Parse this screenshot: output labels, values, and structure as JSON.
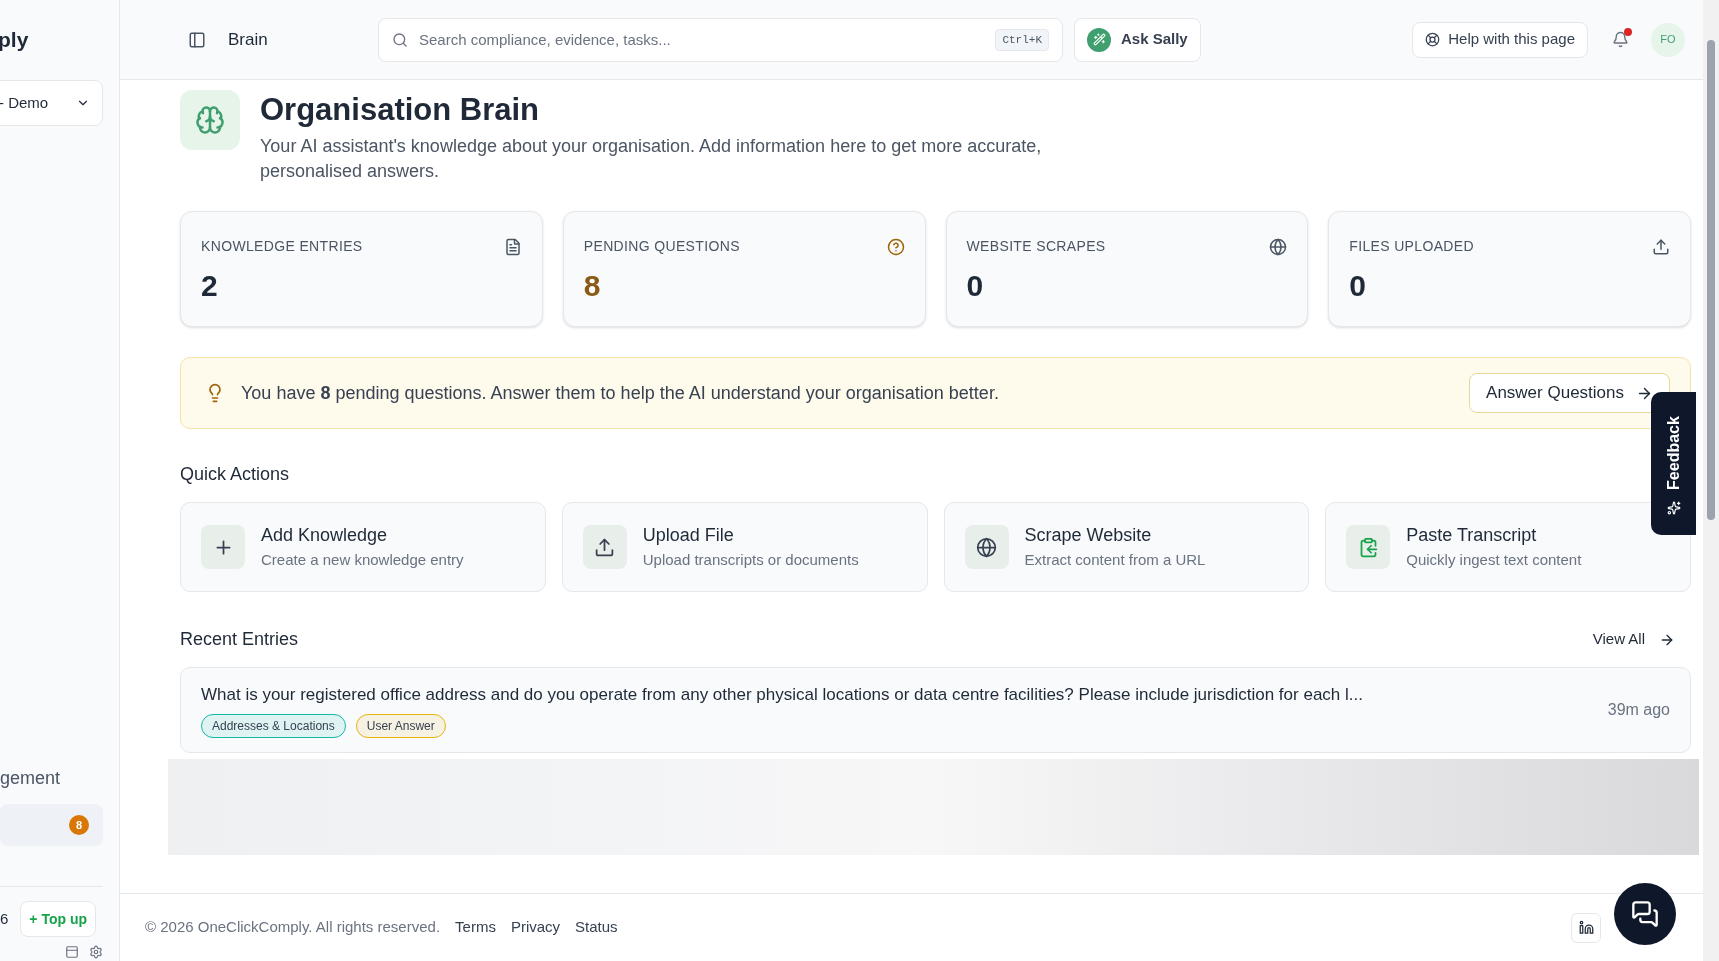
{
  "sidebar": {
    "brand": "ply",
    "org_selector": "- Demo",
    "section_label": "gement",
    "item_badge": "8",
    "credits": "6",
    "top_up": "+ Top up"
  },
  "header": {
    "title": "Brain",
    "search": {
      "placeholder": "Search compliance, evidence, tasks..."
    },
    "shortcut": "Ctrl+K",
    "assistant_button": "Ask Sally",
    "help_button": "Help with this page",
    "notifications_unread": true,
    "avatar": "FO"
  },
  "page": {
    "title": "Organisation Brain",
    "description": "Your AI assistant's knowledge about your organisation. Add information here to get more accurate, personalised answers."
  },
  "stats": [
    {
      "label": "KNOWLEDGE ENTRIES",
      "value": "2",
      "kind": "document",
      "highlighted": false
    },
    {
      "label": "PENDING QUESTIONS",
      "value": "8",
      "kind": "question",
      "highlighted": true
    },
    {
      "label": "WEBSITE SCRAPES",
      "value": "0",
      "kind": "globe",
      "highlighted": false
    },
    {
      "label": "FILES UPLOADED",
      "value": "0",
      "kind": "upload",
      "highlighted": false
    }
  ],
  "banner": {
    "message": "You have **8** pending questions. Answer them to help the AI understand your organisation better.",
    "button": "Answer Questions"
  },
  "quick_actions": {
    "title": "Quick Actions",
    "items": [
      {
        "title": "Add Knowledge",
        "subtitle": "Create a new knowledge entry",
        "kind": "plus"
      },
      {
        "title": "Upload File",
        "subtitle": "Upload transcripts or documents",
        "kind": "upload"
      },
      {
        "title": "Scrape Website",
        "subtitle": "Extract content from a URL",
        "kind": "globe"
      },
      {
        "title": "Paste Transcript",
        "subtitle": "Quickly ingest text content",
        "kind": "clipboard"
      }
    ]
  },
  "recent_entries": {
    "title": "Recent Entries",
    "view_all": "View All",
    "entries": [
      {
        "title": "What is your registered office address and do you operate from any other physical locations or data centre facilities? Please include jurisdiction for each l...",
        "time": "39m ago",
        "tags": [
          {
            "label": "Addresses & Locations",
            "color": "#14b8a6"
          },
          {
            "label": "User Answer",
            "color": "#eab308"
          }
        ]
      }
    ]
  },
  "footer": {
    "copyright": "© 2026 OneClickComply. All rights reserved.",
    "links": [
      "Terms",
      "Privacy",
      "Status"
    ]
  },
  "feedback_tab": "Feedback"
}
